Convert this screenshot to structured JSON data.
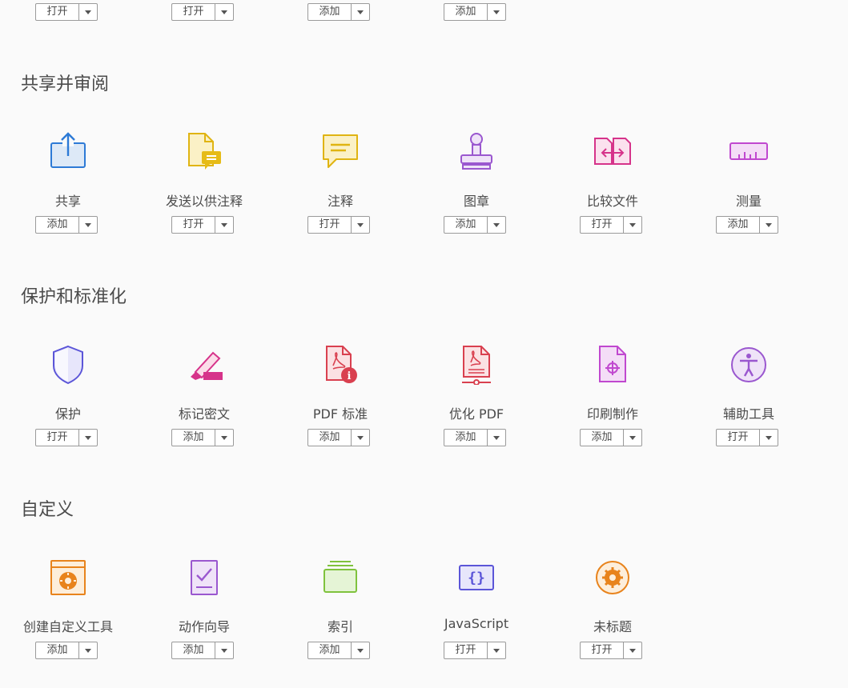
{
  "top_row": [
    {
      "button": "打开"
    },
    {
      "button": "打开"
    },
    {
      "button": "添加"
    },
    {
      "button": "添加"
    }
  ],
  "sections": [
    {
      "title": "共享并审阅",
      "tools": [
        {
          "label": "共享",
          "button": "添加",
          "icon": "share-icon"
        },
        {
          "label": "发送以供注释",
          "button": "打开",
          "icon": "send-for-comments-icon"
        },
        {
          "label": "注释",
          "button": "打开",
          "icon": "comment-icon"
        },
        {
          "label": "图章",
          "button": "添加",
          "icon": "stamp-icon"
        },
        {
          "label": "比较文件",
          "button": "打开",
          "icon": "compare-files-icon"
        },
        {
          "label": "测量",
          "button": "添加",
          "icon": "measure-icon"
        }
      ]
    },
    {
      "title": "保护和标准化",
      "tools": [
        {
          "label": "保护",
          "button": "打开",
          "icon": "protect-icon"
        },
        {
          "label": "标记密文",
          "button": "添加",
          "icon": "redact-icon"
        },
        {
          "label": "PDF 标准",
          "button": "添加",
          "icon": "pdf-standards-icon"
        },
        {
          "label": "优化 PDF",
          "button": "添加",
          "icon": "optimize-pdf-icon"
        },
        {
          "label": "印刷制作",
          "button": "添加",
          "icon": "print-production-icon"
        },
        {
          "label": "辅助工具",
          "button": "打开",
          "icon": "accessibility-icon"
        }
      ]
    },
    {
      "title": "自定义",
      "tools": [
        {
          "label": "创建自定义工具",
          "button": "添加",
          "icon": "create-custom-tool-icon"
        },
        {
          "label": "动作向导",
          "button": "添加",
          "icon": "action-wizard-icon"
        },
        {
          "label": "索引",
          "button": "添加",
          "icon": "index-icon"
        },
        {
          "label": "JavaScript",
          "button": "打开",
          "icon": "javascript-icon"
        },
        {
          "label": "未标题",
          "button": "打开",
          "icon": "untitled-icon"
        }
      ]
    }
  ]
}
